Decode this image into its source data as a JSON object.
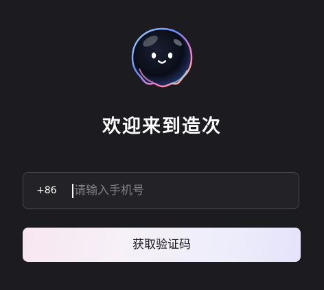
{
  "mascot": {
    "icon": "bubble-mascot-icon"
  },
  "title": "欢迎来到造次",
  "phone": {
    "country_code": "+86",
    "value": "",
    "placeholder": "请输入手机号"
  },
  "get_code_button": {
    "label": "获取验证码"
  },
  "colors": {
    "background": "#1c1b1f",
    "input_border": "#47464c",
    "button_gradient_start": "#f7e6f0",
    "button_gradient_end": "#e5e3fa"
  }
}
